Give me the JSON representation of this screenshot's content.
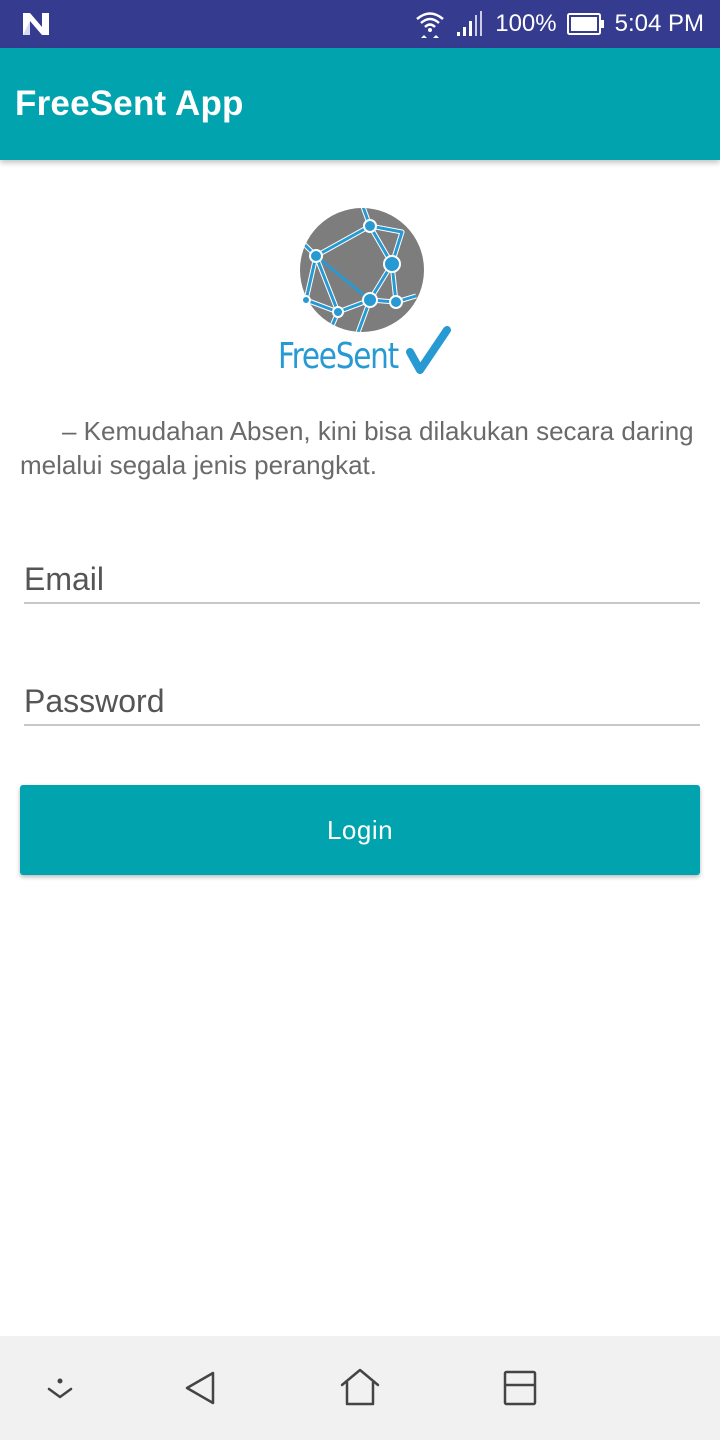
{
  "status_bar": {
    "notification_icon": "n-logo-icon",
    "wifi_icon": "wifi-icon",
    "signal_icon": "signal-icon",
    "battery_percent": "100%",
    "battery_icon": "battery-icon",
    "time": "5:04 PM"
  },
  "app_bar": {
    "title": "FreeSent App"
  },
  "logo": {
    "brand_text": "FreeSent"
  },
  "tagline": "– Kemudahan Absen, kini bisa dilakukan secara daring melalui segala jenis perangkat.",
  "form": {
    "email": {
      "placeholder": "Email",
      "value": ""
    },
    "password": {
      "placeholder": "Password",
      "value": ""
    },
    "login_label": "Login"
  },
  "nav_bar": {
    "buttons": [
      "collapse-down-icon",
      "back-icon",
      "home-icon",
      "recents-icon"
    ]
  },
  "colors": {
    "status_bar": "#353b8f",
    "primary": "#00a3ae",
    "logo_blue": "#2799d3",
    "logo_gray": "#7d7d7d"
  }
}
